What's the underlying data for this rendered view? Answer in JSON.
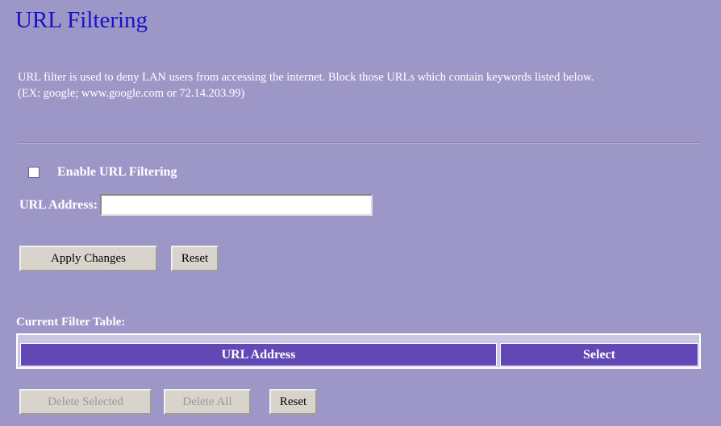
{
  "page": {
    "title": "URL Filtering"
  },
  "description": {
    "line1": "URL filter is used to deny LAN users from accessing the internet. Block those URLs which contain keywords listed below.",
    "line2": "(EX: google; www.google.com or 72.14.203.99)"
  },
  "form": {
    "enable_label": "Enable URL Filtering",
    "enable_checked": false,
    "url_label": "URL Address:",
    "url_value": "",
    "apply_label": "Apply Changes",
    "reset_label": "Reset"
  },
  "table": {
    "caption": "Current Filter Table:",
    "columns": [
      "URL Address",
      "Select"
    ],
    "rows": []
  },
  "footer_buttons": {
    "delete_selected_label": "Delete Selected",
    "delete_selected_enabled": false,
    "delete_all_label": "Delete All",
    "delete_all_enabled": false,
    "reset_label": "Reset"
  },
  "colors": {
    "background": "#9d97c7",
    "title": "#1a12c8",
    "table_header": "#6248b4"
  }
}
